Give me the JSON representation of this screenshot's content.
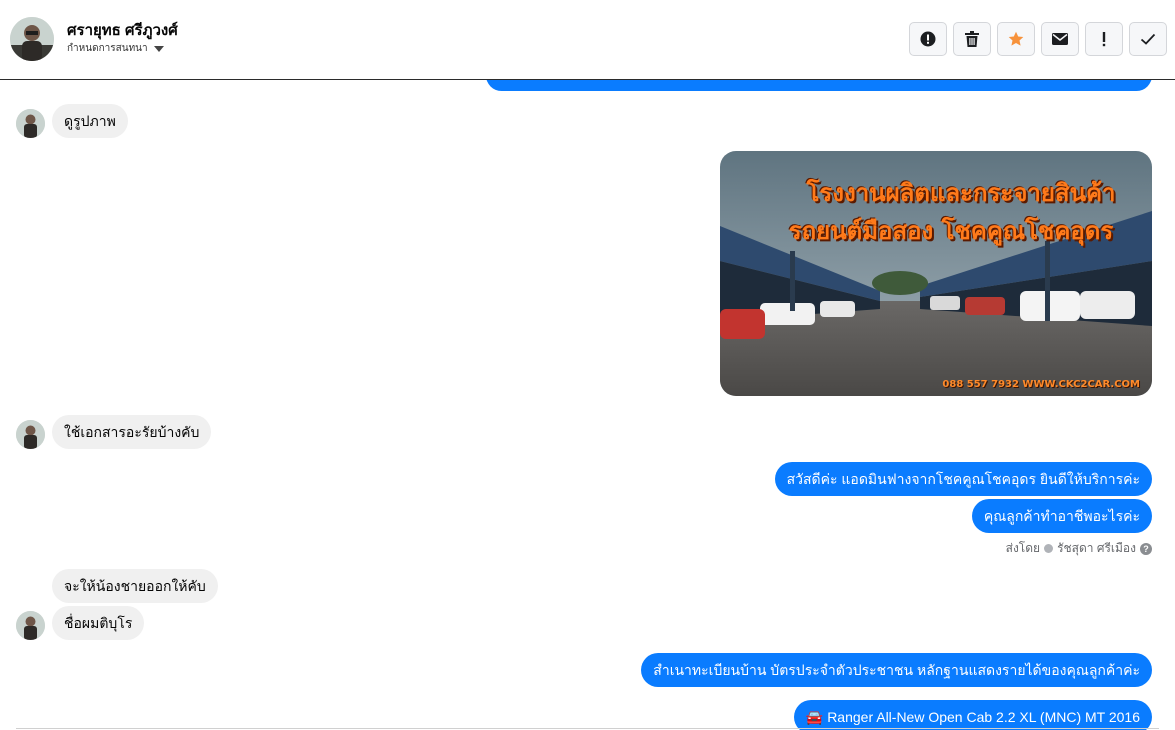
{
  "header": {
    "contact_name": "ศรายุทธ ศรีภูวงศ์",
    "assign_label": "กำหนดการสนทนา",
    "tools": [
      {
        "name": "report-icon",
        "glyph": "!"
      },
      {
        "name": "trash-icon"
      },
      {
        "name": "star-icon"
      },
      {
        "name": "mail-icon"
      },
      {
        "name": "exclamation-icon",
        "glyph": "!"
      },
      {
        "name": "check-icon"
      }
    ]
  },
  "colors": {
    "outgoing_bubble": "#0a7cff",
    "incoming_bubble": "#f0f0f0",
    "star": "#f7923b"
  },
  "messages": {
    "in_1": "ดูรูปภาพ",
    "photo_line1": "โรงงานผลิตและกระจายสินค้า",
    "photo_line2": "รถยนต์มือสอง โชคคูณโชคอุดร",
    "photo_caption": "088 557 7932 WWW.CKC2CAR.COM",
    "in_2": "ใช้เอกสารอะรัยบ้างคับ",
    "out_1": "สวัสดีค่ะ แอดมินฟางจากโชคคูณโชคอุดร ยินดีให้บริการค่ะ",
    "out_2": "คุณลูกค้าทำอาชีพอะไรค่ะ",
    "sent_by_label": "ส่งโดย",
    "sent_by_name": "รัชสุดา ศรีเมือง",
    "in_3": "จะให้น้องชายออกให้คับ",
    "in_4": "ชื่อผมติบุโร",
    "out_3": "สำเนาทะเบียนบ้าน บัตรประจำตัวประชาชน หลักฐานแสดงรายได้ของคุณลูกค้าค่ะ",
    "out_4": "🚘 Ranger All-New Open Cab 2.2 XL (MNC) MT 2016"
  }
}
